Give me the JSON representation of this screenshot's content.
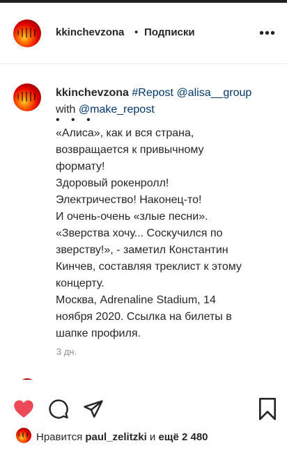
{
  "header": {
    "username": "kkinchevzona",
    "separator": "•",
    "follow_label": "Подписки",
    "more_label": "•••"
  },
  "caption": {
    "username": "kkinchevzona",
    "hashtag": "#Repost",
    "mention1": "@alisa__group",
    "with_word": "with",
    "mention2": "@make_repost",
    "dots": "• • •",
    "lines": [
      "«Алиса», как и вся страна,",
      "возвращается к привычному",
      "формату!",
      "Здоровый рокенролл!",
      "Электричество! Наконец-то!",
      "И очень-очень «злые песни».",
      "«Зверства хочу... Соскучился по",
      "зверству!», - заметил Константин",
      "Кинчев, составляя треклист к этому",
      "концерту.",
      "Москва, Adrenaline Stadium, 14",
      "ноября 2020. Ссылка на билеты в",
      "шапке профиля."
    ],
    "time": "3 дн."
  },
  "actions": {
    "like_icon": "heart-filled-icon",
    "comment_icon": "comment-icon",
    "share_icon": "paper-plane-icon",
    "save_icon": "bookmark-icon",
    "like_color": "#ed4956"
  },
  "likes": {
    "prefix": "Нравится",
    "user": "paul_zelitzki",
    "middle": "и",
    "count": "ещё 2 480"
  }
}
